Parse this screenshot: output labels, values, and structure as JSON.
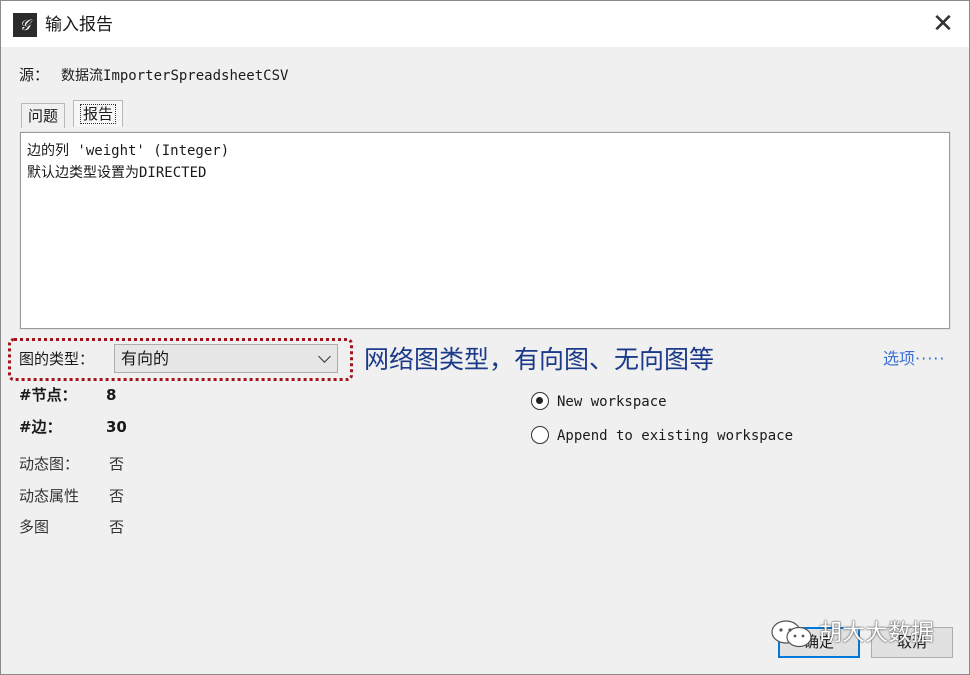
{
  "window": {
    "title": "输入报告",
    "close_glyph": "✕",
    "app_icon_glyph": "𝒢"
  },
  "source": {
    "label": "源：",
    "value": "数据流ImporterSpreadsheetCSV"
  },
  "tabs": [
    {
      "label": "问题",
      "active": false
    },
    {
      "label": "报告",
      "active": true
    }
  ],
  "report": {
    "lines": [
      "边的列 'weight' (Integer)",
      "默认边类型设置为DIRECTED"
    ]
  },
  "graph_type": {
    "label": "图的类型：",
    "selected": "有向的"
  },
  "annotation": {
    "text": "网络图类型，有向图、无向图等",
    "color": "#1b3a8a"
  },
  "options_link": {
    "label": "选项",
    "dots": "·····"
  },
  "stats": {
    "nodes_label": "#节点：",
    "nodes_value": "8",
    "edges_label": "#边：",
    "edges_value": "30"
  },
  "info": {
    "dynamic_graph_label": "动态图：",
    "dynamic_graph_value": "否",
    "dynamic_attr_label": "动态属性",
    "dynamic_attr_value": "否",
    "multi_graph_label": "多图",
    "multi_graph_value": "否"
  },
  "workspace": {
    "new_label": "New workspace",
    "new_selected": true,
    "append_label": "Append to existing workspace",
    "append_selected": false
  },
  "buttons": {
    "ok_label": "确定",
    "cancel_label": "取消"
  },
  "watermark": {
    "text": "胡大大数据"
  },
  "colors": {
    "accent": "#0078d7",
    "annotation_border": "#a3141c",
    "link": "#3b6fd6"
  }
}
